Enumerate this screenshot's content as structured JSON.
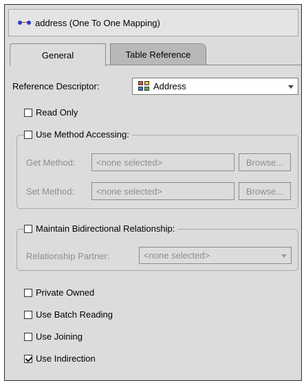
{
  "header": {
    "title": "address (One To One Mapping)",
    "icon": "mapping-icon"
  },
  "tabs": [
    {
      "label": "General",
      "selected": true
    },
    {
      "label": "Table Reference",
      "selected": false
    }
  ],
  "reference_descriptor": {
    "label": "Reference Descriptor:",
    "value": "Address",
    "icon": "descriptor-icon"
  },
  "read_only": {
    "label": "Read Only",
    "checked": false
  },
  "method_accessing": {
    "label": "Use Method Accessing:",
    "checked": false,
    "get_label": "Get Method:",
    "get_value": "<none selected>",
    "set_label": "Set Method:",
    "set_value": "<none selected>",
    "browse_label": "Browse..."
  },
  "bidirectional": {
    "label": "Maintain Bidirectional Relationship:",
    "checked": false,
    "partner_label": "Relationship Partner:",
    "partner_value": "<none selected>"
  },
  "options": [
    {
      "label": "Private Owned",
      "checked": false
    },
    {
      "label": "Use Batch Reading",
      "checked": false
    },
    {
      "label": "Use Joining",
      "checked": false
    },
    {
      "label": "Use Indirection",
      "checked": true
    }
  ]
}
